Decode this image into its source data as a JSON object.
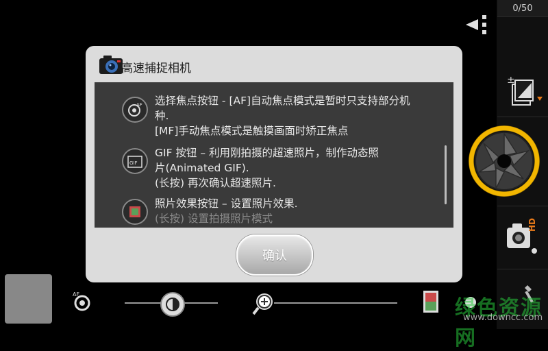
{
  "counter": "0/50",
  "dialog": {
    "title": "高速捕捉相机",
    "items": [
      {
        "icon": "af-focus-icon",
        "lines": [
          "选择焦点按钮 - [AF]自动焦点模式是暂时只支持部分机",
          "种.",
          "[MF]手动焦点模式是触摸画面时矫正焦点"
        ]
      },
      {
        "icon": "gif-icon",
        "lines": [
          "GIF 按钮 – 利用刚拍摄的超速照片，制作动态照",
          "片(Animated GIF).",
          "(长按) 再次确认超速照片."
        ]
      },
      {
        "icon": "photo-effect-icon",
        "lines": [
          "照片效果按钮 – 设置照片效果.",
          "(长按) 设置拍摄照片模式"
        ]
      }
    ],
    "confirm_label": "确认"
  },
  "rail": {
    "hd_label": "HD"
  },
  "watermark": {
    "text": "绿色资源网",
    "url": "www.downcc.com"
  },
  "colors": {
    "shutter_ring": "#f2b600",
    "dialog_bg": "#dcdcdc",
    "dialog_body": "#3a3a3a",
    "accent_orange": "#e87a1a"
  }
}
